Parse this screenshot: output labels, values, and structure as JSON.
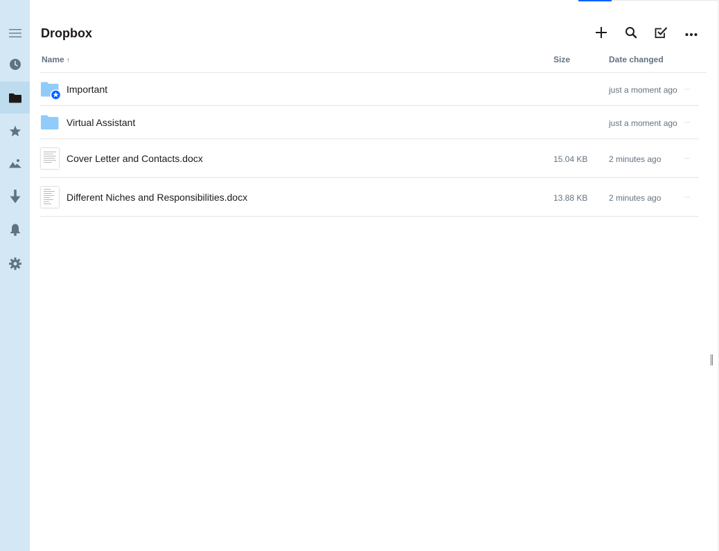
{
  "header": {
    "title": "Dropbox"
  },
  "toolbar": {
    "add_icon": "plus-icon",
    "search_icon": "search-icon",
    "select_icon": "checkbox-edit-icon",
    "more_icon": "more-horizontal-icon"
  },
  "sidebar": {
    "items": [
      {
        "icon": "hamburger-menu-icon"
      },
      {
        "icon": "recent-clock-icon"
      },
      {
        "icon": "folder-icon",
        "active": true
      },
      {
        "icon": "star-icon"
      },
      {
        "icon": "photos-icon"
      },
      {
        "icon": "download-icon"
      },
      {
        "icon": "bell-icon"
      },
      {
        "icon": "gear-icon"
      }
    ]
  },
  "columns": {
    "name": "Name",
    "sort_arrow": "↑",
    "size": "Size",
    "date": "Date changed"
  },
  "files": [
    {
      "name": "Important",
      "type": "folder-starred",
      "size": "",
      "date": "just a moment ago",
      "more": "···"
    },
    {
      "name": "Virtual Assistant",
      "type": "folder",
      "size": "",
      "date": "just a moment ago",
      "more": "···"
    },
    {
      "name": "Cover Letter and Contacts.docx",
      "type": "docx",
      "size": "15.04 KB",
      "date": "2 minutes ago",
      "more": "···"
    },
    {
      "name": "Different Niches and Responsibilities.docx",
      "type": "docx",
      "size": "13.88 KB",
      "date": "2 minutes ago",
      "more": "···"
    }
  ],
  "colors": {
    "sidebar_bg": "#d3e8f4",
    "accent": "#0061fe",
    "folder": "#90cbfa",
    "text": "#1e1919",
    "muted": "#637282"
  }
}
